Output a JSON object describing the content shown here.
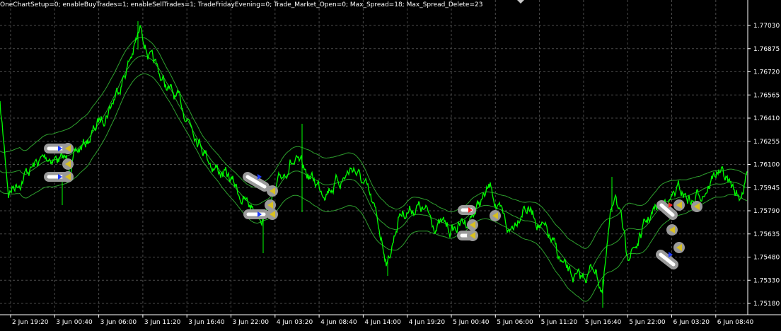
{
  "chart": {
    "info_text": "OneChartSetup=0; enableBuyTrades=1; enableSellTrades=1; TradeFridayEvening=0; Trade_Market_Open=0; Max_Spread=18; Max_Spread_Delete=23",
    "price_labels": [
      "1.77030",
      "1.76875",
      "1.76720",
      "1.76565",
      "1.76410",
      "1.76255",
      "1.76100",
      "1.75945",
      "1.75790",
      "1.75635",
      "1.75480",
      "1.75330",
      "1.75180"
    ],
    "time_labels": [
      "2 Jun 19:20",
      "3 Jun 00:40",
      "3 Jun 06:00",
      "3 Jun 11:20",
      "3 Jun 16:40",
      "3 Jun 22:00",
      "4 Jun 03:20",
      "4 Jun 08:40",
      "4 Jun 14:00",
      "4 Jun 19:20",
      "5 Jun 00:40",
      "5 Jun 06:00",
      "5 Jun 11:20",
      "5 Jun 16:40",
      "5 Jun 22:00",
      "6 Jun 03:20",
      "6 Jun 08:40"
    ],
    "price_range": [
      1.7518,
      1.7718
    ],
    "colors": {
      "background": "#000000",
      "grid": "#4a4a4a",
      "price_line": "#00ff00",
      "band_line": "#2ea02e",
      "axis_text": "#ffffff",
      "marker_body": "#9a9a9a",
      "buy_arrow": "#1e3cff",
      "sell_arrow": "#ff2020",
      "exit_marker": "#d8c020"
    },
    "icons": [
      "scroll-down-icon",
      "trade-entry-marker-icon",
      "trade-exit-marker-icon"
    ]
  }
}
